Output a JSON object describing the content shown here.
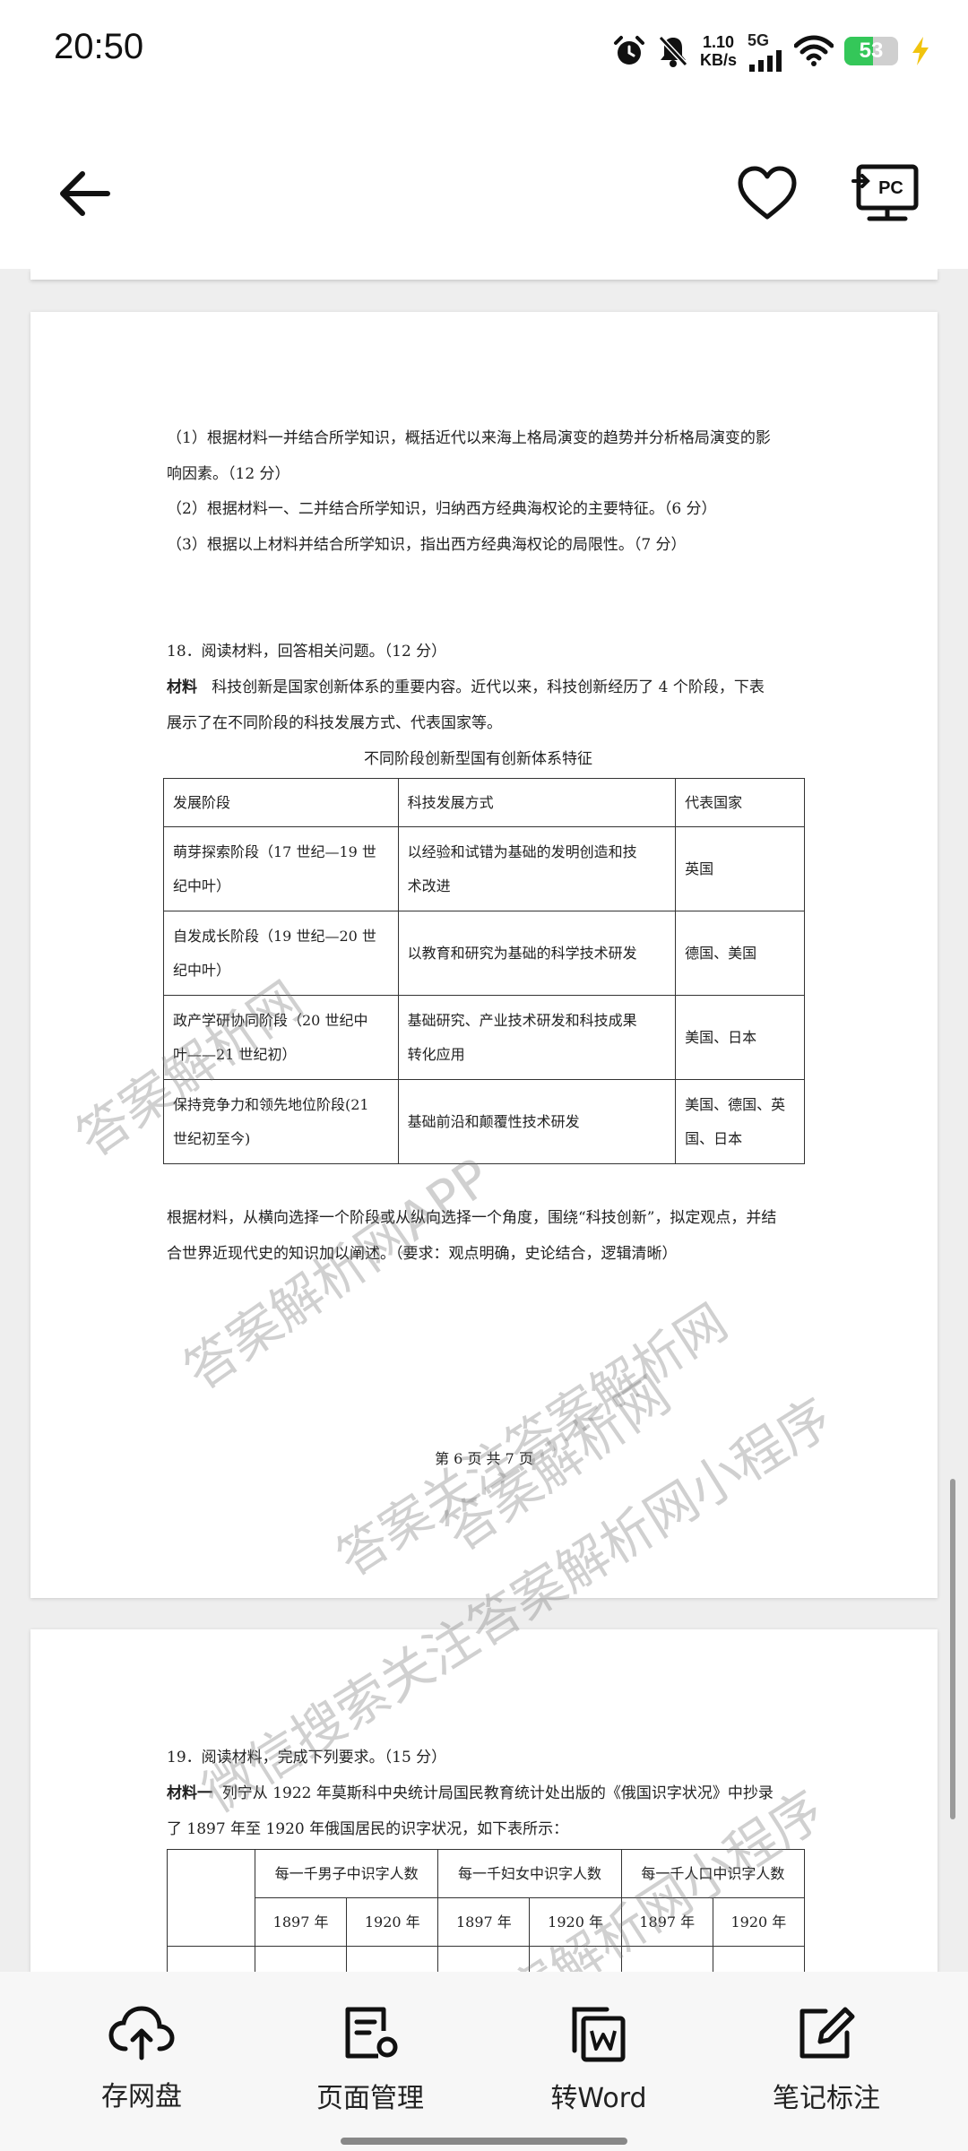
{
  "status_bar": {
    "time": "20:50",
    "net_speed_value": "1.10",
    "net_speed_unit": "KB/s",
    "network_type": "5G",
    "battery_percent": "53",
    "battery_level": 0.53,
    "icons": [
      "alarm-icon",
      "bell-off-icon",
      "signal-icon",
      "wifi-icon",
      "battery-icon",
      "charging-icon"
    ]
  },
  "toolbar": {
    "icons": [
      "back-arrow-icon",
      "heart-icon",
      "pc-cast-icon"
    ],
    "cast_badge": "PC"
  },
  "page6": {
    "lines": [
      "（1）根据材料一并结合所学知识，概括近代以来海上格局演变的趋势并分析格局演变的影",
      "响因素。（12 分）",
      "（2）根据材料一、二并结合所学知识，归纳西方经典海权论的主要特征。（6 分）",
      "（3）根据以上材料并结合所学知识，指出西方经典海权论的局限性。（7 分）"
    ],
    "q18_title": "18．阅读材料，回答相关问题。（12 分）",
    "q18_label": "材料",
    "q18_line1": "科技创新是国家创新体系的重要内容。近代以来，科技创新经历了 4 个阶段，下表",
    "q18_line2": "展示了在不同阶段的科技发展方式、代表国家等。",
    "table_caption": "不同阶段创新型国有创新体系特征",
    "table_header": [
      "发展阶段",
      "科技发展方式",
      "代表国家"
    ],
    "table_rows": [
      {
        "stage1": "萌芽探索阶段（17 世纪—19 世",
        "stage2": "纪中叶）",
        "mode1": "以经验和试错为基础的发明创造和技",
        "mode2": "术改进",
        "country1": "英国",
        "country2": ""
      },
      {
        "stage1": "自发成长阶段（19 世纪—20 世",
        "stage2": "纪中叶）",
        "mode1": "以教育和研究为基础的科学技术研发",
        "mode2": "",
        "country1": "德国、美国",
        "country2": ""
      },
      {
        "stage1": "政产学研协同阶段（20 世纪中",
        "stage2": "叶——21 世纪初）",
        "mode1": "基础研究、产业技术研发和科技成果",
        "mode2": "转化应用",
        "country1": "美国、日本",
        "country2": ""
      },
      {
        "stage1": "保持竞争力和领先地位阶段(21",
        "stage2": "世纪初至今)",
        "mode1": "基础前沿和颠覆性技术研发",
        "mode2": "",
        "country1": "美国、德国、英",
        "country2": "国、日本"
      }
    ],
    "prompt_line1": "根据材料，从横向选择一个阶段或从纵向选择一个角度，围绕“科技创新”，拟定观点，并结",
    "prompt_line2": "合世界近现代史的知识加以阐述。（要求：观点明确，史论结合，逻辑清晰）",
    "page_number": "第 6 页 共 7 页"
  },
  "page7": {
    "q19_title": "19．阅读材料，完成下列要求。（15 分）",
    "q19_label": "材料一",
    "q19_line1": "列宁从 1922 年莫斯科中央统计局国民教育统计处出版的《俄国识字状况》中抄录",
    "q19_line2": "了 1897 年至 1920 年俄国居民的识字状况，如下表所示：",
    "table_groups": [
      "每一千男子中识字人数",
      "每一千妇女中识字人数",
      "每一千人口中识字人数"
    ],
    "table_years": [
      "1897 年",
      "1920 年",
      "1897 年",
      "1920 年",
      "1897 年",
      "1920 年"
    ]
  },
  "watermarks": [
    "答案解析网",
    "答案解析网APP",
    "答案解析网",
    "答案关注答案解析网",
    "微信搜索关注答案解析网小程序",
    "答案解析网小程序"
  ],
  "bottom_bar": {
    "items": [
      {
        "label": "存网盘",
        "icon": "cloud-upload-icon"
      },
      {
        "label": "页面管理",
        "icon": "page-manage-icon"
      },
      {
        "label": "转Word",
        "icon": "word-convert-icon"
      },
      {
        "label": "笔记标注",
        "icon": "note-edit-icon"
      }
    ]
  }
}
